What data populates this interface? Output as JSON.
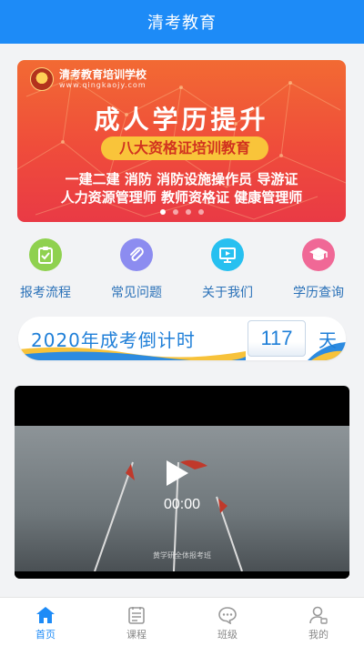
{
  "header": {
    "title": "清考教育"
  },
  "banner": {
    "school_name": "清考教育培训学校",
    "school_url": "www.qingkaojy.com",
    "title": "成人学历提升",
    "pill": "八大资格证培训教育",
    "line1": "一建二建 消防 消防设施操作员 导游证",
    "line2": "人力资源管理师 教师资格证 健康管理师",
    "dots": [
      true,
      false,
      false,
      false
    ]
  },
  "quick_links": [
    {
      "label": "报考流程",
      "icon": "clipboard-icon",
      "color": "#8fd14f"
    },
    {
      "label": "常见问题",
      "icon": "paperclip-icon",
      "color": "#8c8cf0"
    },
    {
      "label": "关于我们",
      "icon": "presentation-icon",
      "color": "#27c0f0"
    },
    {
      "label": "学历查询",
      "icon": "graduation-cap-icon",
      "color": "#f06896"
    }
  ],
  "countdown": {
    "text": "2020年成考倒计时",
    "days": "117",
    "unit": "天"
  },
  "video": {
    "time": "00:00",
    "caption": "黄学研全体报考班"
  },
  "tabs": [
    {
      "label": "首页",
      "icon": "home-icon",
      "active": true
    },
    {
      "label": "课程",
      "icon": "course-icon",
      "active": false
    },
    {
      "label": "班级",
      "icon": "chat-icon",
      "active": false
    },
    {
      "label": "我的",
      "icon": "user-icon",
      "active": false
    }
  ],
  "colors": {
    "primary": "#1d8bf7",
    "link": "#2a71b8"
  }
}
